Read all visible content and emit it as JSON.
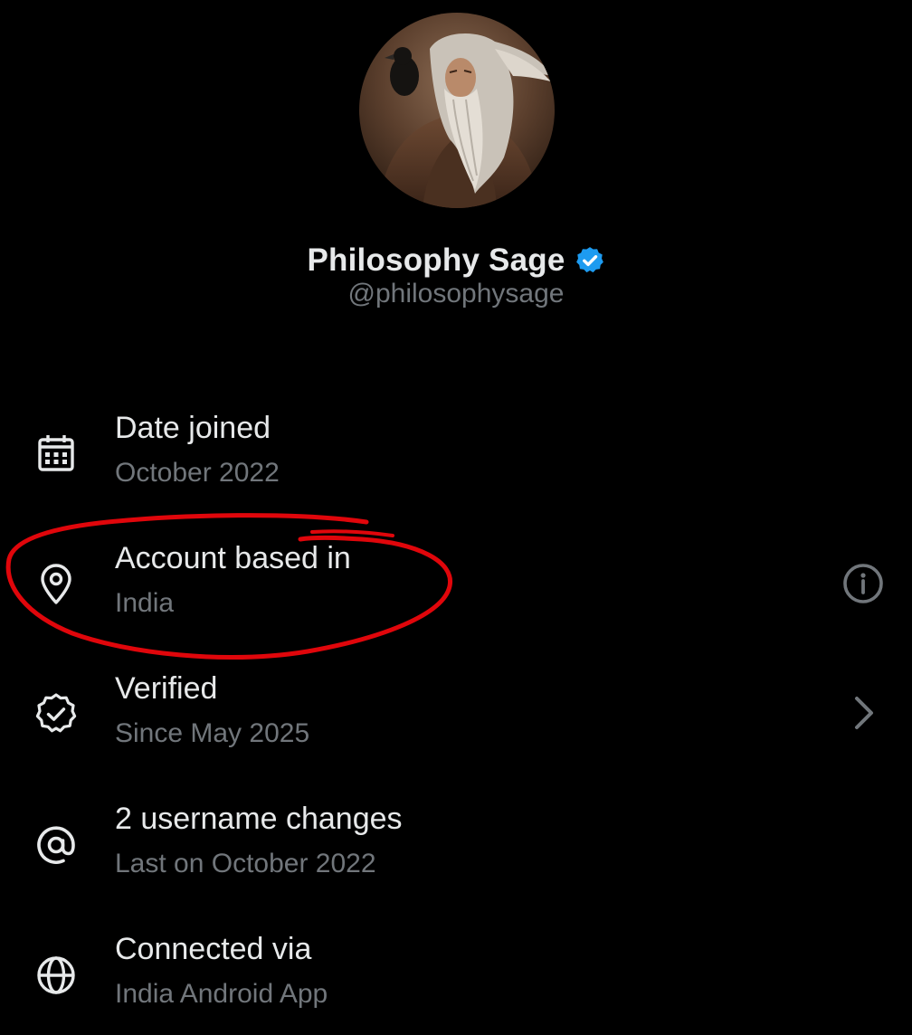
{
  "profile": {
    "display_name": "Philosophy Sage",
    "handle": "@philosophysage",
    "verified_badge_color": "#1d9bf0"
  },
  "info_items": [
    {
      "icon": "calendar-icon",
      "title": "Date joined",
      "subtitle": "October 2022"
    },
    {
      "icon": "location-pin-icon",
      "title": "Account based in",
      "subtitle": "India",
      "trailing_icon": "info-icon"
    },
    {
      "icon": "verified-icon",
      "title": "Verified",
      "subtitle": "Since May 2025",
      "trailing_icon": "chevron-right-icon"
    },
    {
      "icon": "at-sign-icon",
      "title": "2 username changes",
      "subtitle": "Last on October 2022"
    },
    {
      "icon": "globe-icon",
      "title": "Connected via",
      "subtitle": "India Android App"
    }
  ],
  "colors": {
    "background": "#000000",
    "primary_text": "#e7e9ea",
    "secondary_text": "#71767b",
    "annotation": "#e0060b"
  }
}
